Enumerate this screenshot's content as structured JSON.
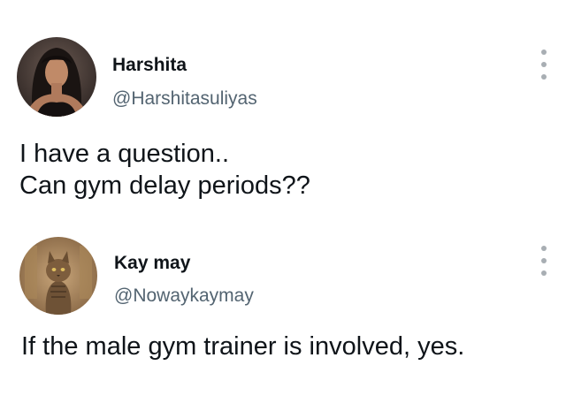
{
  "tweets": [
    {
      "display_name": "Harshita",
      "handle": "@Harshitasuliyas",
      "avatar_icon": "profile-photo-woman",
      "more_icon": "more-vertical-icon",
      "text_lines": [
        "I have a question..",
        "Can gym delay periods??"
      ]
    },
    {
      "display_name": "Kay may",
      "handle": "@Nowaykaymay",
      "avatar_icon": "profile-photo-cat",
      "more_icon": "more-vertical-icon",
      "text_lines": [
        "If the male gym trainer is involved, yes."
      ]
    }
  ],
  "colors": {
    "text_primary": "#0f1419",
    "text_secondary": "#536471",
    "dots": "#a8aeb3",
    "background": "#ffffff"
  }
}
